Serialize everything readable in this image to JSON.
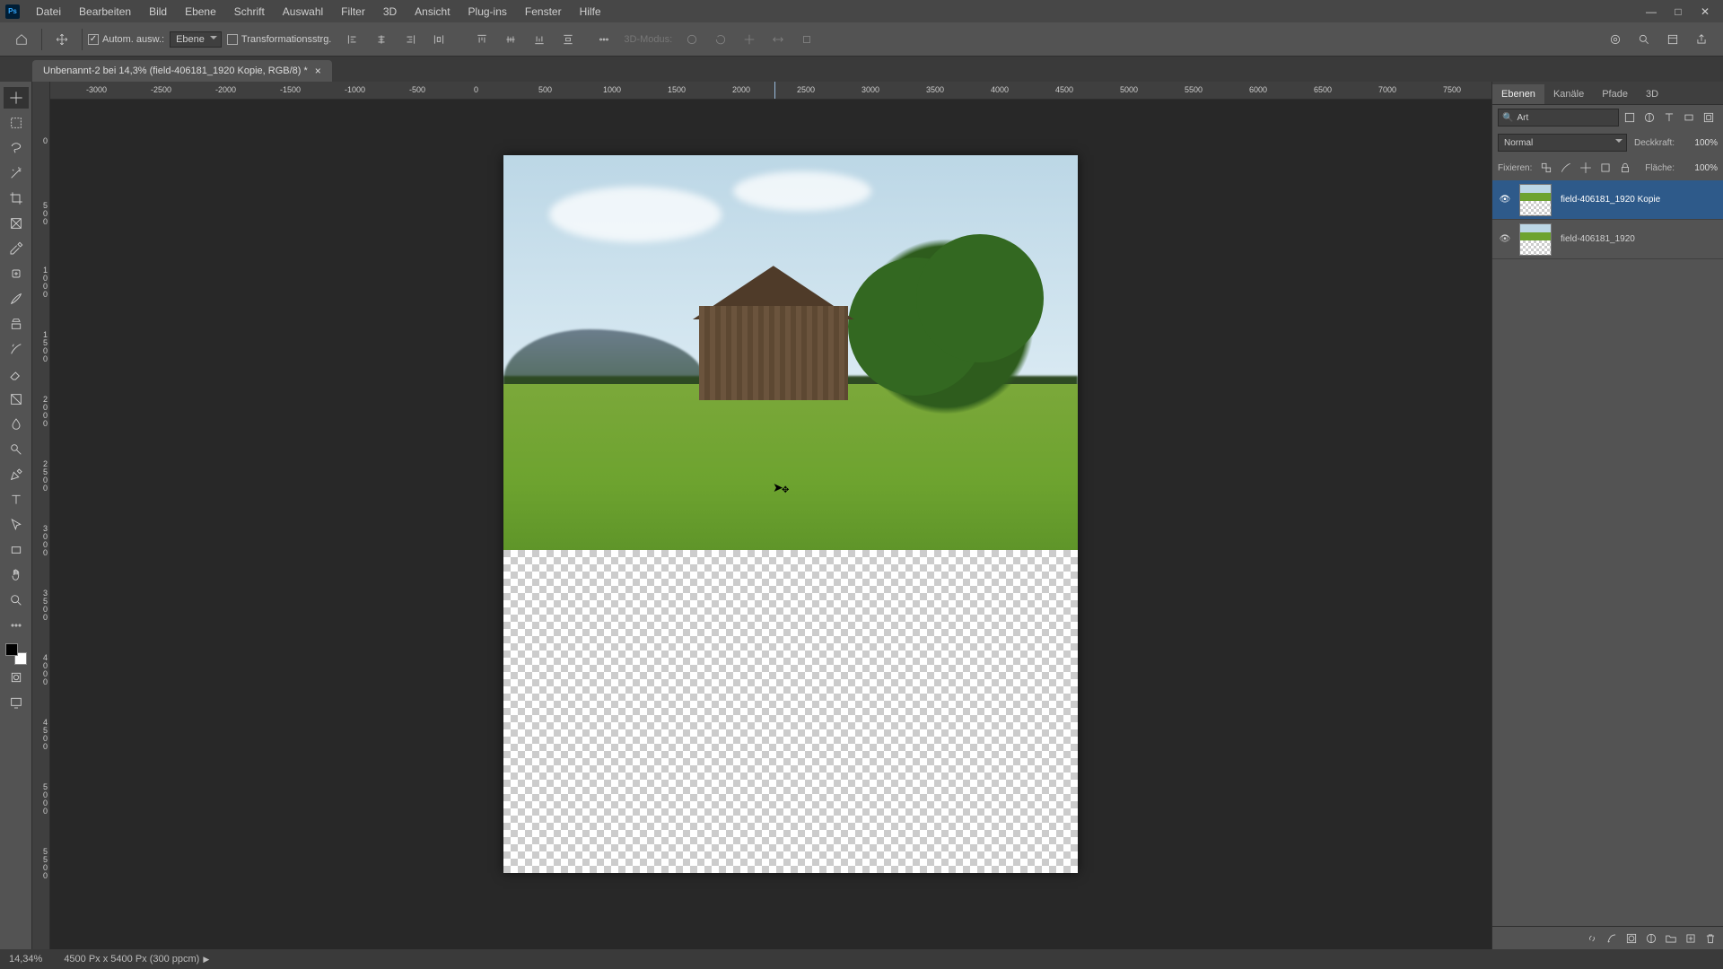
{
  "menubar": [
    "Datei",
    "Bearbeiten",
    "Bild",
    "Ebene",
    "Schrift",
    "Auswahl",
    "Filter",
    "3D",
    "Ansicht",
    "Plug-ins",
    "Fenster",
    "Hilfe"
  ],
  "optionsbar": {
    "autoselect_label": "Autom. ausw.:",
    "autoselect_target": "Ebene",
    "transform_label": "Transformationsstrg.",
    "mode3d_label": "3D-Modus:"
  },
  "doctab": {
    "title": "Unbenannt-2 bei 14,3% (field-406181_1920 Kopie, RGB/8) *"
  },
  "ruler_h": [
    "-3000",
    "-2500",
    "-2000",
    "-1500",
    "-1000",
    "-500",
    "0",
    "500",
    "1000",
    "1500",
    "2000",
    "2500",
    "3000",
    "3500",
    "4000",
    "4500",
    "5000",
    "5500",
    "6000",
    "6500",
    "7000",
    "7500"
  ],
  "ruler_v": [
    "0",
    "500",
    "1000",
    "1500",
    "2000",
    "2500",
    "3000",
    "3500",
    "4000",
    "4500",
    "5000",
    "5500"
  ],
  "panels": {
    "tabs": [
      "Ebenen",
      "Kanäle",
      "Pfade",
      "3D"
    ],
    "search_placeholder": "Art",
    "blend_mode": "Normal",
    "opacity_label": "Deckkraft:",
    "opacity_value": "100%",
    "lock_label": "Fixieren:",
    "fill_label": "Fläche:",
    "fill_value": "100%"
  },
  "layers": [
    {
      "name": "field-406181_1920 Kopie",
      "visible": true,
      "active": true
    },
    {
      "name": "field-406181_1920",
      "visible": true,
      "active": false
    }
  ],
  "statusbar": {
    "zoom": "14,34%",
    "docinfo": "4500 Px x 5400 Px (300 ppcm)"
  }
}
